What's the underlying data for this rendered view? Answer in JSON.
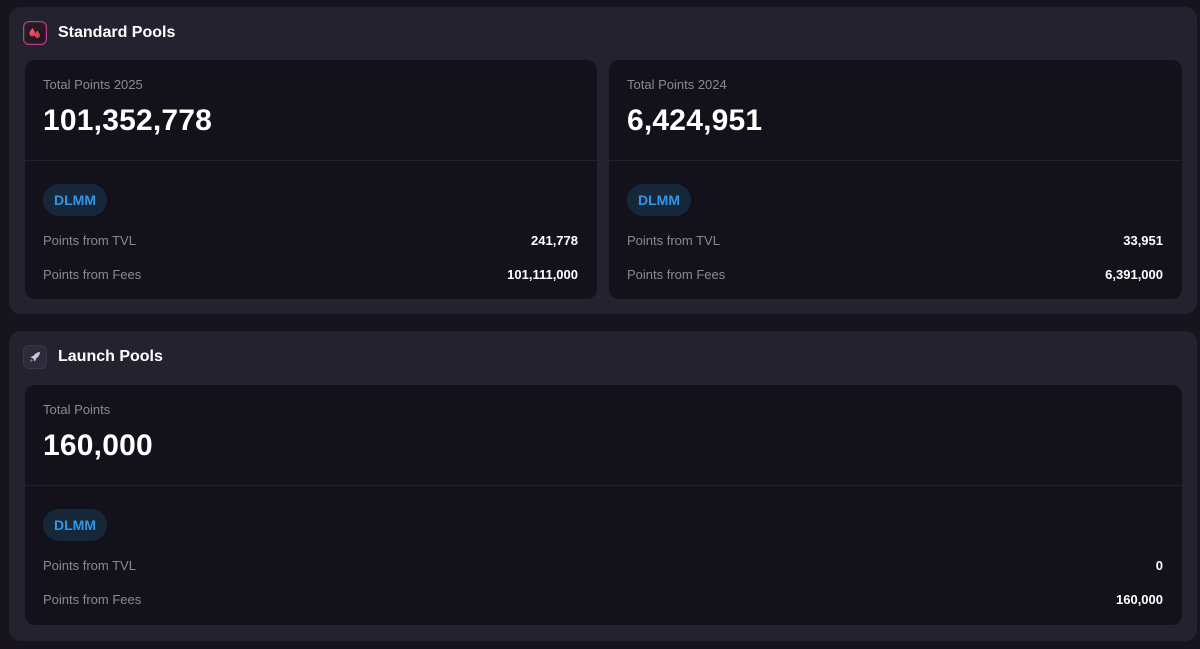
{
  "standard": {
    "title": "Standard Pools",
    "icon": "liquidity-drops-icon",
    "cards": [
      {
        "label": "Total Points 2025",
        "total": "101,352,778",
        "badge": "DLMM",
        "tvl_label": "Points from TVL",
        "tvl_value": "241,778",
        "fees_label": "Points from Fees",
        "fees_value": "101,111,000"
      },
      {
        "label": "Total Points 2024",
        "total": "6,424,951",
        "badge": "DLMM",
        "tvl_label": "Points from TVL",
        "tvl_value": "33,951",
        "fees_label": "Points from Fees",
        "fees_value": "6,391,000"
      }
    ]
  },
  "launch": {
    "title": "Launch Pools",
    "icon": "rocket-icon",
    "card": {
      "label": "Total Points",
      "total": "160,000",
      "badge": "DLMM",
      "tvl_label": "Points from TVL",
      "tvl_value": "0",
      "fees_label": "Points from Fees",
      "fees_value": "160,000"
    }
  },
  "colors": {
    "page_bg": "#17141d",
    "section_bg": "#24222f",
    "card_bg": "#13121b",
    "badge_bg": "#17273a",
    "badge_text": "#2f97e6",
    "muted_text": "#8a8898"
  }
}
